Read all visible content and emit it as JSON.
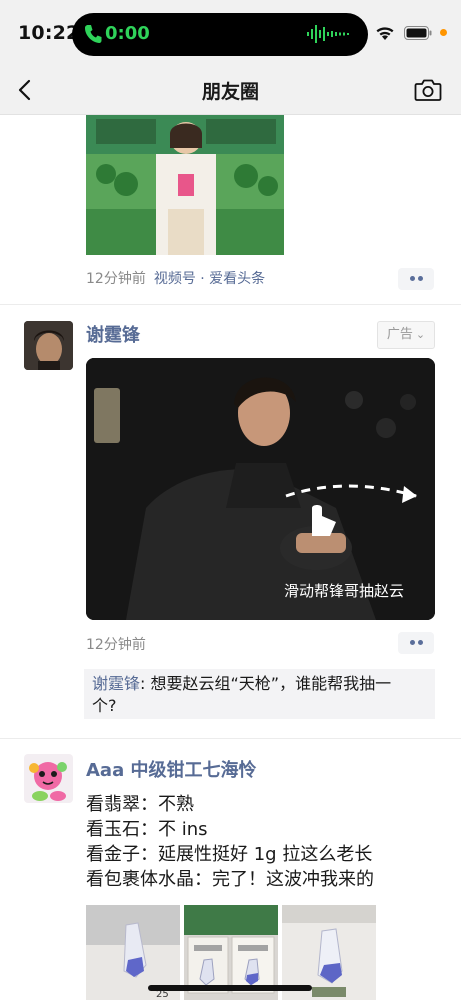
{
  "status_bar": {
    "time": "10:22",
    "call_duration": "0:00",
    "icons": [
      "phone-icon",
      "waveform-icon",
      "wifi-icon",
      "battery-icon"
    ]
  },
  "nav": {
    "title": "朋友圈",
    "back_icon": "chevron-left-icon",
    "camera_icon": "camera-icon"
  },
  "posts": [
    {
      "time": "12分钟前",
      "source": "视频号 · 爱看头条"
    },
    {
      "author": "谢霆锋",
      "ad_label": "广告",
      "video_caption": "滑动帮锋哥抽赵云",
      "time": "12分钟前",
      "comment": {
        "author": "谢霆锋",
        "line1": ": 想要赵云组“天枪”，谁能帮我抽一",
        "line2": "个?"
      }
    },
    {
      "author": "Aaa 中级钳工七海怜",
      "lines": [
        "看翡翠：不熟",
        "看玉石：不 ins",
        "看金子：延展性挺好 1g 拉这么老长",
        "看包裹体水晶：完了！这波冲我来的"
      ],
      "thumb_label": "25"
    }
  ],
  "colors": {
    "link": "#576b95",
    "call_green": "#2fd35a",
    "accent_orange": "#ff9500"
  }
}
